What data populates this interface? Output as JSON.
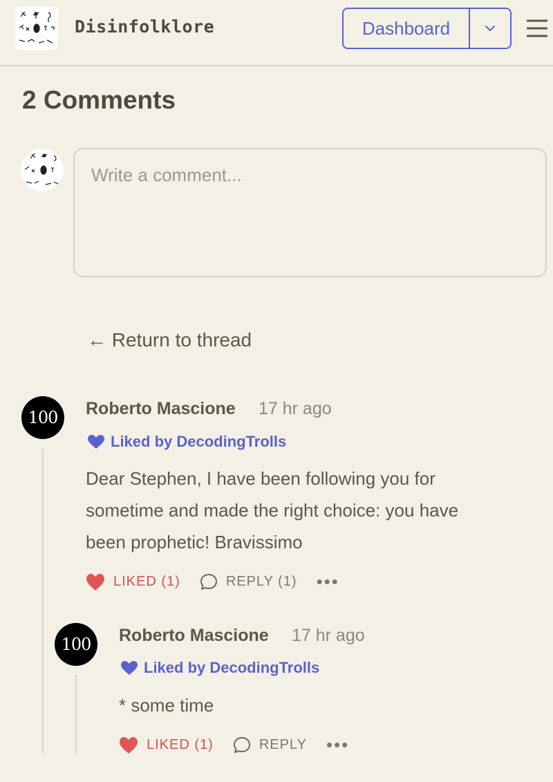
{
  "header": {
    "brand": "Disinfolklore",
    "dashboard_label": "Dashboard"
  },
  "comments_title": "2 Comments",
  "composer": {
    "placeholder": "Write a comment..."
  },
  "return_link": "← Return to thread",
  "comments": [
    {
      "avatar_text": "100",
      "author": "Roberto Mascione",
      "time": "17 hr ago",
      "liked_by": "Liked by DecodingTrolls",
      "lines": [
        "Dear Stephen, I have been following you for",
        "sometime and made the right choice: you have",
        "been prophetic! Bravissimo"
      ],
      "like_label": "LIKED (1)",
      "reply_label": "REPLY (1)",
      "more": "•••"
    },
    {
      "avatar_text": "100",
      "author": "Roberto Mascione",
      "time": "17 hr ago",
      "liked_by": "Liked by DecodingTrolls",
      "lines": [
        "* some time"
      ],
      "like_label": "LIKED (1)",
      "reply_label": "REPLY",
      "more": "•••"
    }
  ],
  "colors": {
    "accent": "#5b62cc",
    "liked": "#d94f4f",
    "background": "#f3f1e6"
  },
  "icons": [
    "publication-logo-icon",
    "chevron-down-icon",
    "hamburger-menu-icon",
    "heart-icon",
    "speech-bubble-icon",
    "more-icon"
  ]
}
